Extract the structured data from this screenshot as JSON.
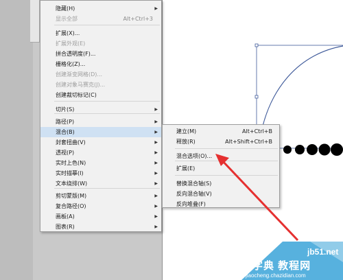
{
  "main_menu": {
    "items": [
      {
        "label": "隐藏(H)",
        "shortcut": "",
        "submenu": true,
        "disabled": false
      },
      {
        "label": "显示全部",
        "shortcut": "Alt+Ctrl+3",
        "submenu": false,
        "disabled": true
      },
      {
        "label": "扩展(X)...",
        "shortcut": "",
        "submenu": false,
        "disabled": false
      },
      {
        "label": "扩展外观(E)",
        "shortcut": "",
        "submenu": false,
        "disabled": true
      },
      {
        "label": "拼合透明度(F)...",
        "shortcut": "",
        "submenu": false,
        "disabled": false
      },
      {
        "label": "栅格化(Z)...",
        "shortcut": "",
        "submenu": false,
        "disabled": false
      },
      {
        "label": "创建渐变网格(D)...",
        "shortcut": "",
        "submenu": false,
        "disabled": true
      },
      {
        "label": "创建对象马赛克(J)...",
        "shortcut": "",
        "submenu": false,
        "disabled": true
      },
      {
        "label": "创建裁切标记(C)",
        "shortcut": "",
        "submenu": false,
        "disabled": false
      },
      {
        "label": "切片(S)",
        "shortcut": "",
        "submenu": true,
        "disabled": false
      },
      {
        "label": "路径(P)",
        "shortcut": "",
        "submenu": true,
        "disabled": false
      },
      {
        "label": "混合(B)",
        "shortcut": "",
        "submenu": true,
        "disabled": false,
        "highlight": true
      },
      {
        "label": "封套扭曲(V)",
        "shortcut": "",
        "submenu": true,
        "disabled": false
      },
      {
        "label": "透视(P)",
        "shortcut": "",
        "submenu": true,
        "disabled": false
      },
      {
        "label": "实时上色(N)",
        "shortcut": "",
        "submenu": true,
        "disabled": false
      },
      {
        "label": "实时描摹(I)",
        "shortcut": "",
        "submenu": true,
        "disabled": false
      },
      {
        "label": "文本绕排(W)",
        "shortcut": "",
        "submenu": true,
        "disabled": false
      },
      {
        "label": "剪切蒙版(M)",
        "shortcut": "",
        "submenu": true,
        "disabled": false
      },
      {
        "label": "复合路径(O)",
        "shortcut": "",
        "submenu": true,
        "disabled": false
      },
      {
        "label": "画板(A)",
        "shortcut": "",
        "submenu": true,
        "disabled": false
      },
      {
        "label": "图表(R)",
        "shortcut": "",
        "submenu": true,
        "disabled": false
      }
    ]
  },
  "blend_submenu": {
    "items": [
      {
        "label": "建立(M)",
        "shortcut": "Alt+Ctrl+B"
      },
      {
        "label": "释放(R)",
        "shortcut": "Alt+Shift+Ctrl+B"
      },
      {
        "label": "混合选项(O)...",
        "shortcut": ""
      },
      {
        "label": "扩展(E)",
        "shortcut": ""
      },
      {
        "label": "替换混合轴(S)",
        "shortcut": ""
      },
      {
        "label": "反向混合轴(V)",
        "shortcut": ""
      },
      {
        "label": "反向堆叠(F)",
        "shortcut": ""
      }
    ]
  },
  "icons": {
    "submenu_arrow": "chevron-right-icon",
    "annotation_arrow": "red-arrow-icon"
  },
  "watermark": {
    "line1": "jb51.net",
    "line2": "查字典 教程网",
    "line3": "jiaocheng.chazidian.com"
  },
  "colors": {
    "highlight": "#cfe1f3",
    "selection_stroke": "#3f5a9a",
    "annotation_arrow": "#e53030",
    "watermark_band": "#3aa3d8"
  }
}
